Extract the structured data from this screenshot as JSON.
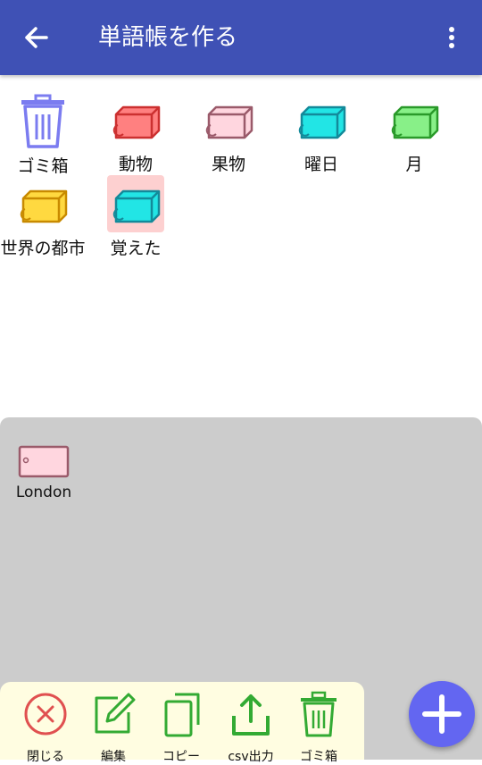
{
  "appbar": {
    "title": "単語帳を作る",
    "back_icon": "arrow-left-icon",
    "menu_icon": "more-vert-icon",
    "color": "#3f51b5"
  },
  "wordbooks": [
    {
      "label": "ゴミ箱",
      "icon": "trash-icon",
      "color": "#7b7cf0"
    },
    {
      "label": "動物",
      "icon": "book-icon",
      "color": "#ff8080"
    },
    {
      "label": "果物",
      "icon": "book-icon",
      "color": "#ffd6df"
    },
    {
      "label": "曜日",
      "icon": "book-icon",
      "color": "#22e5e5"
    },
    {
      "label": "月",
      "icon": "book-icon",
      "color": "#88f088"
    },
    {
      "label": "世界の都市",
      "icon": "book-icon",
      "color": "#ffd940"
    },
    {
      "label": "覚えた",
      "icon": "book-icon",
      "color": "#22e5e5",
      "selected": true
    }
  ],
  "cards": [
    {
      "label": "London",
      "icon": "tag-card-icon",
      "color": "#ffd6df"
    }
  ],
  "toolbar": {
    "items": [
      {
        "label": "閉じる",
        "icon": "close-circle-icon"
      },
      {
        "label": "編集",
        "icon": "edit-icon"
      },
      {
        "label": "コピー",
        "icon": "copy-icon"
      },
      {
        "label": "csv出力",
        "icon": "share-icon"
      },
      {
        "label": "ゴミ箱",
        "icon": "trash-icon"
      }
    ]
  },
  "fab": {
    "icon": "plus-icon",
    "color": "#6366f1"
  }
}
